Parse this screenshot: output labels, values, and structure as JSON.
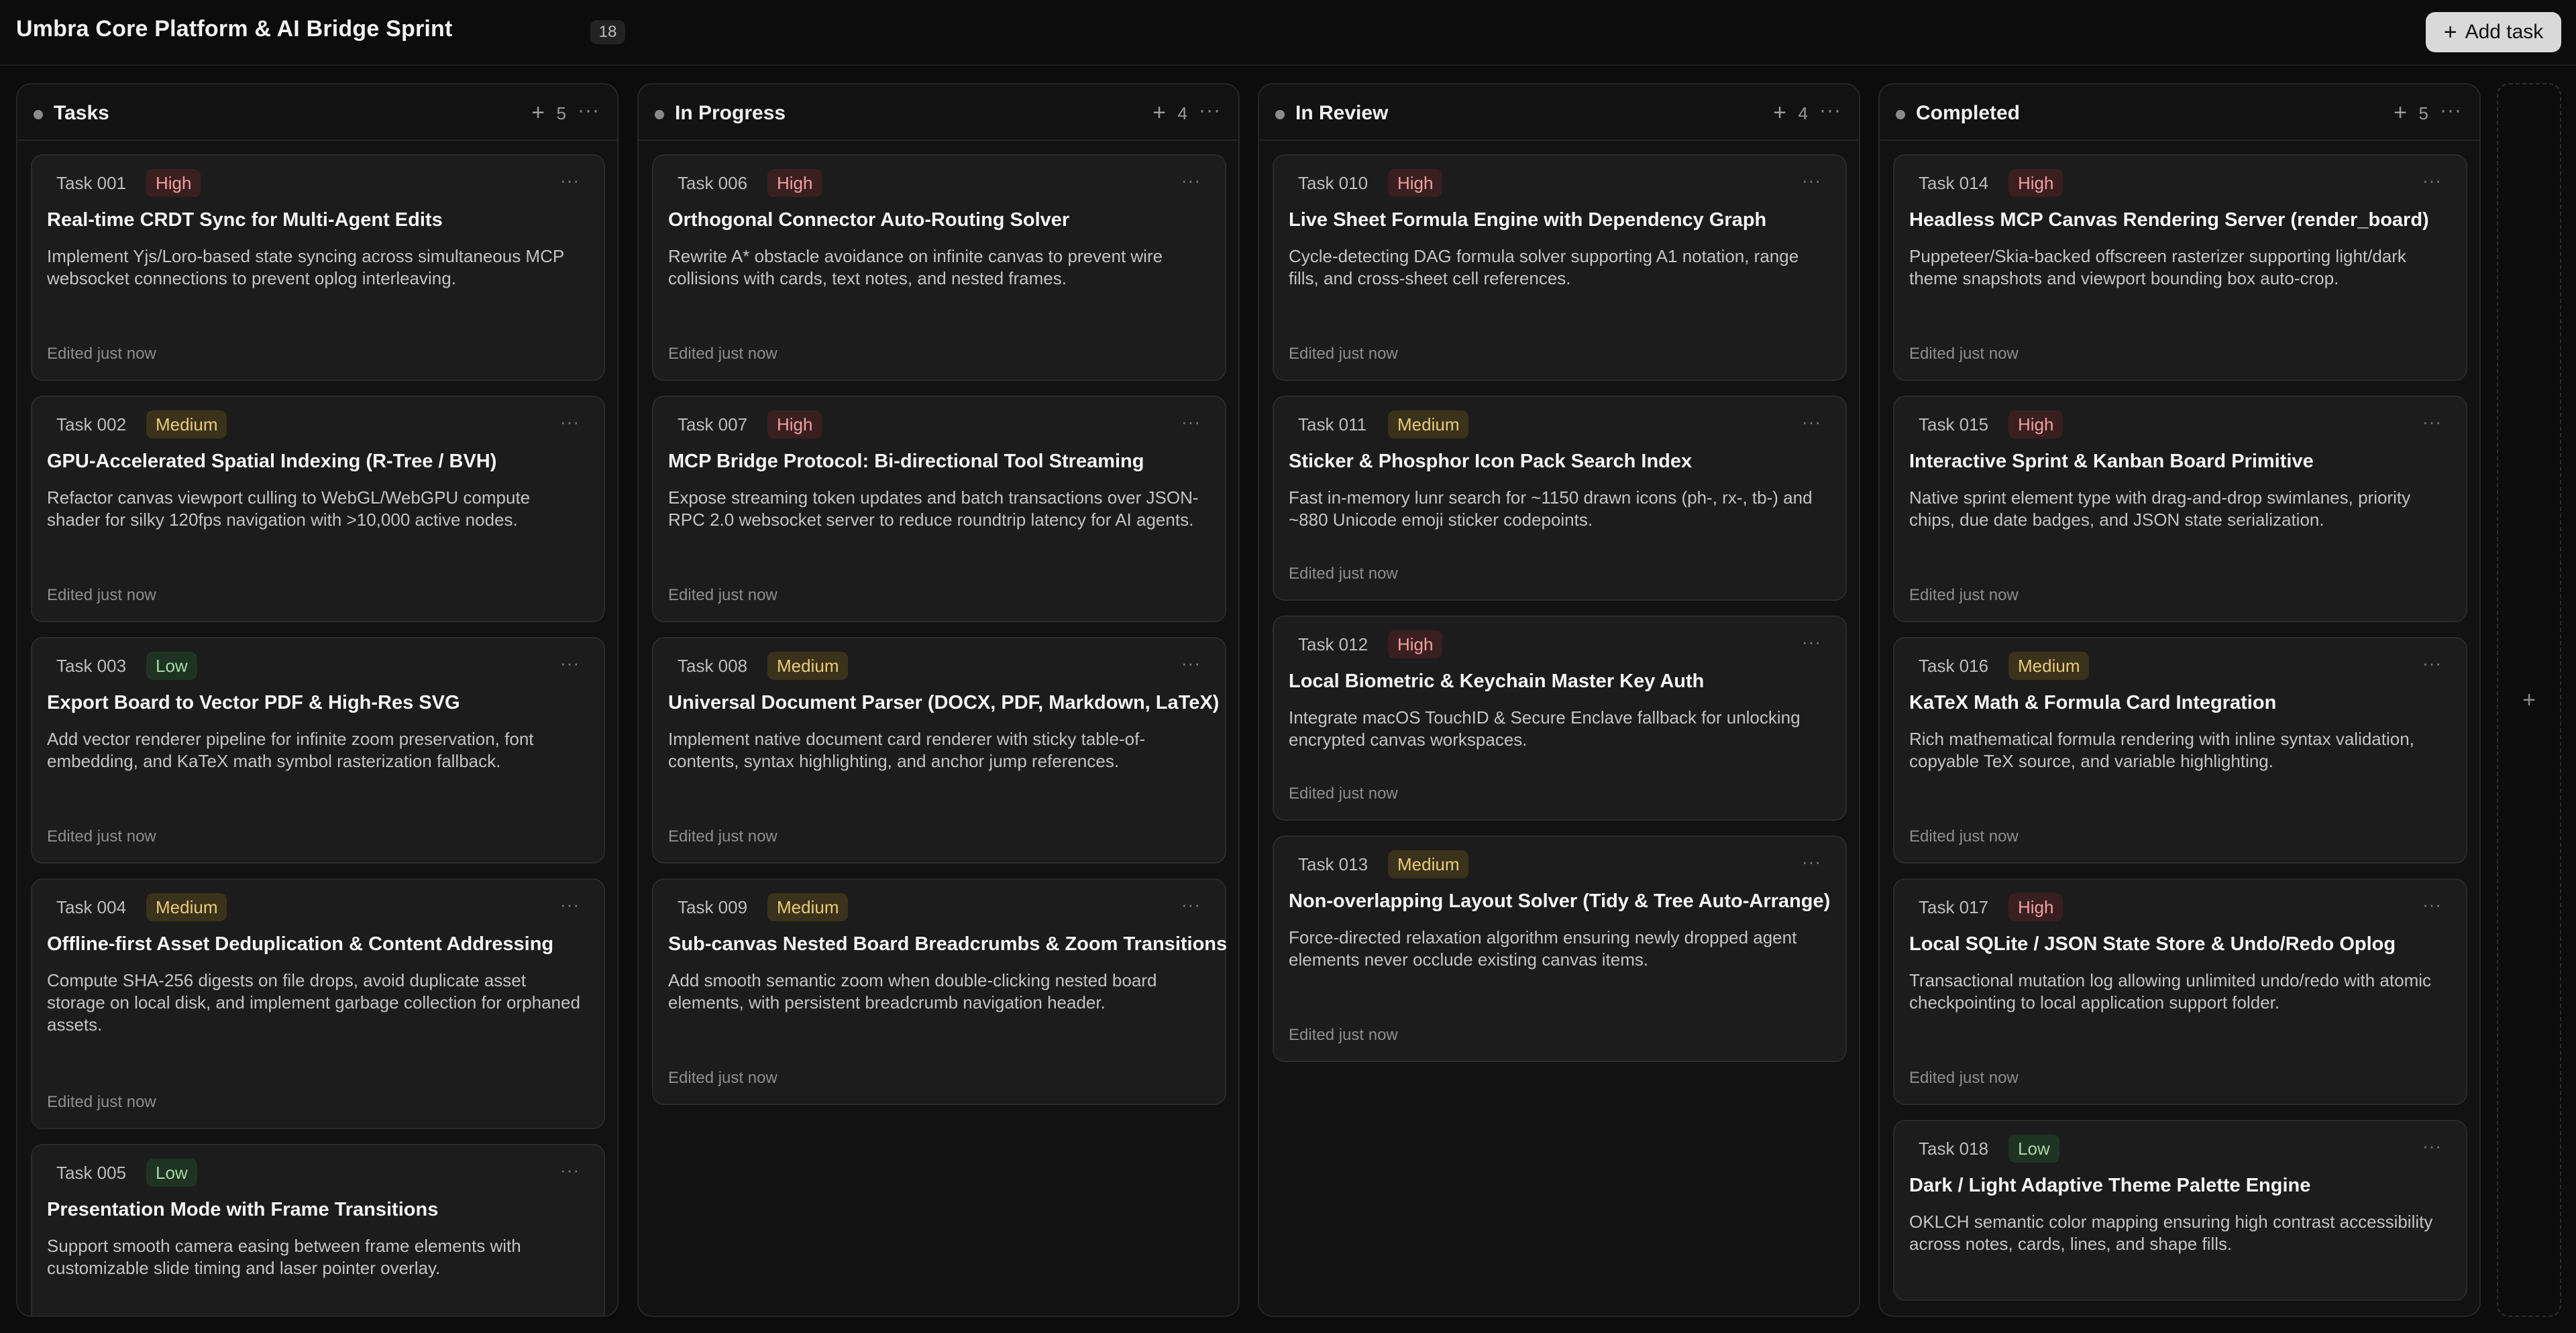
{
  "header": {
    "title": "Umbra Core Platform & AI Bridge Sprint",
    "task_count": "18",
    "add_task_label": "Add task",
    "add_task_icon": "+"
  },
  "columns": [
    {
      "title": "Tasks",
      "count": "5",
      "cards": [
        {
          "id": "Task 001",
          "priority": "High",
          "title": "Real-time CRDT Sync for Multi-Agent Edits",
          "desc": "Implement Yjs/Loro-based state syncing across simultaneous MCP websocket connections to prevent oplog interleaving.",
          "edited": "Edited just now"
        },
        {
          "id": "Task 002",
          "priority": "Medium",
          "title": "GPU-Accelerated Spatial Indexing (R-Tree / BVH)",
          "desc": "Refactor canvas viewport culling to WebGL/WebGPU compute shader for silky 120fps navigation with >10,000 active nodes.",
          "edited": "Edited just now"
        },
        {
          "id": "Task 003",
          "priority": "Low",
          "title": "Export Board to Vector PDF & High-Res SVG",
          "desc": "Add vector renderer pipeline for infinite zoom preservation, font embedding, and KaTeX math symbol rasterization fallback.",
          "edited": "Edited just now"
        },
        {
          "id": "Task 004",
          "priority": "Medium",
          "title": "Offline-first Asset Deduplication & Content Addressing",
          "desc": "Compute SHA-256 digests on file drops, avoid duplicate asset storage on local disk, and implement garbage collection for orphaned assets.",
          "edited": "Edited just now"
        },
        {
          "id": "Task 005",
          "priority": "Low",
          "title": "Presentation Mode with Frame Transitions",
          "desc": "Support smooth camera easing between frame elements with customizable slide timing and laser pointer overlay.",
          "edited": ""
        }
      ]
    },
    {
      "title": "In Progress",
      "count": "4",
      "cards": [
        {
          "id": "Task 006",
          "priority": "High",
          "title": "Orthogonal Connector Auto-Routing Solver",
          "desc": "Rewrite A* obstacle avoidance on infinite canvas to prevent wire collisions with cards, text notes, and nested frames.",
          "edited": "Edited just now"
        },
        {
          "id": "Task 007",
          "priority": "High",
          "title": "MCP Bridge Protocol: Bi-directional Tool Streaming",
          "desc": "Expose streaming token updates and batch transactions over JSON-RPC 2.0 websocket server to reduce roundtrip latency for AI agents.",
          "edited": "Edited just now"
        },
        {
          "id": "Task 008",
          "priority": "Medium",
          "title": "Universal Document Parser (DOCX, PDF, Markdown, LaTeX)",
          "desc": "Implement native document card renderer with sticky table-of-contents, syntax highlighting, and anchor jump references.",
          "edited": "Edited just now"
        },
        {
          "id": "Task 009",
          "priority": "Medium",
          "title": "Sub-canvas Nested Board Breadcrumbs & Zoom Transitions",
          "desc": "Add smooth semantic zoom when double-clicking nested board elements, with persistent breadcrumb navigation header.",
          "edited": "Edited just now"
        }
      ]
    },
    {
      "title": "In Review",
      "count": "4",
      "cards": [
        {
          "id": "Task 010",
          "priority": "High",
          "title": "Live Sheet Formula Engine with Dependency Graph",
          "desc": "Cycle-detecting DAG formula solver supporting A1 notation, range fills, and cross-sheet cell references.",
          "edited": "Edited just now"
        },
        {
          "id": "Task 011",
          "priority": "Medium",
          "title": "Sticker & Phosphor Icon Pack Search Index",
          "desc": "Fast in-memory lunr search for ~1150 drawn icons (ph-, rx-, tb-) and ~880 Unicode emoji sticker codepoints.",
          "edited": "Edited just now"
        },
        {
          "id": "Task 012",
          "priority": "High",
          "title": "Local Biometric & Keychain Master Key Auth",
          "desc": "Integrate macOS TouchID & Secure Enclave fallback for unlocking encrypted canvas workspaces.",
          "edited": "Edited just now"
        },
        {
          "id": "Task 013",
          "priority": "Medium",
          "title": "Non-overlapping Layout Solver (Tidy & Tree Auto-Arrange)",
          "desc": "Force-directed relaxation algorithm ensuring newly dropped agent elements never occlude existing canvas items.",
          "edited": "Edited just now"
        }
      ]
    },
    {
      "title": "Completed",
      "count": "5",
      "cards": [
        {
          "id": "Task 014",
          "priority": "High",
          "title": "Headless MCP Canvas Rendering Server (render_board)",
          "desc": "Puppeteer/Skia-backed offscreen rasterizer supporting light/dark theme snapshots and viewport bounding box auto-crop.",
          "edited": "Edited just now"
        },
        {
          "id": "Task 015",
          "priority": "High",
          "title": "Interactive Sprint & Kanban Board Primitive",
          "desc": "Native sprint element type with drag-and-drop swimlanes, priority chips, due date badges, and JSON state serialization.",
          "edited": "Edited just now"
        },
        {
          "id": "Task 016",
          "priority": "Medium",
          "title": "KaTeX Math & Formula Card Integration",
          "desc": "Rich mathematical formula rendering with inline syntax validation, copyable TeX source, and variable highlighting.",
          "edited": "Edited just now"
        },
        {
          "id": "Task 017",
          "priority": "High",
          "title": "Local SQLite / JSON State Store & Undo/Redo Oplog",
          "desc": "Transactional mutation log allowing unlimited undo/redo with atomic checkpointing to local application support folder.",
          "edited": "Edited just now"
        },
        {
          "id": "Task 018",
          "priority": "Low",
          "title": "Dark / Light Adaptive Theme Palette Engine",
          "desc": "OKLCH semantic color mapping ensuring high contrast accessibility across notes, cards, lines, and shape fills.",
          "edited": ""
        }
      ]
    }
  ],
  "icons": {
    "plus": "+",
    "more": "···"
  },
  "colors": {
    "background": "#0c0c0c",
    "card": "#1c1c1c",
    "high": "#f2a0a0",
    "medium": "#eacb7a",
    "low": "#a6d9a8"
  }
}
